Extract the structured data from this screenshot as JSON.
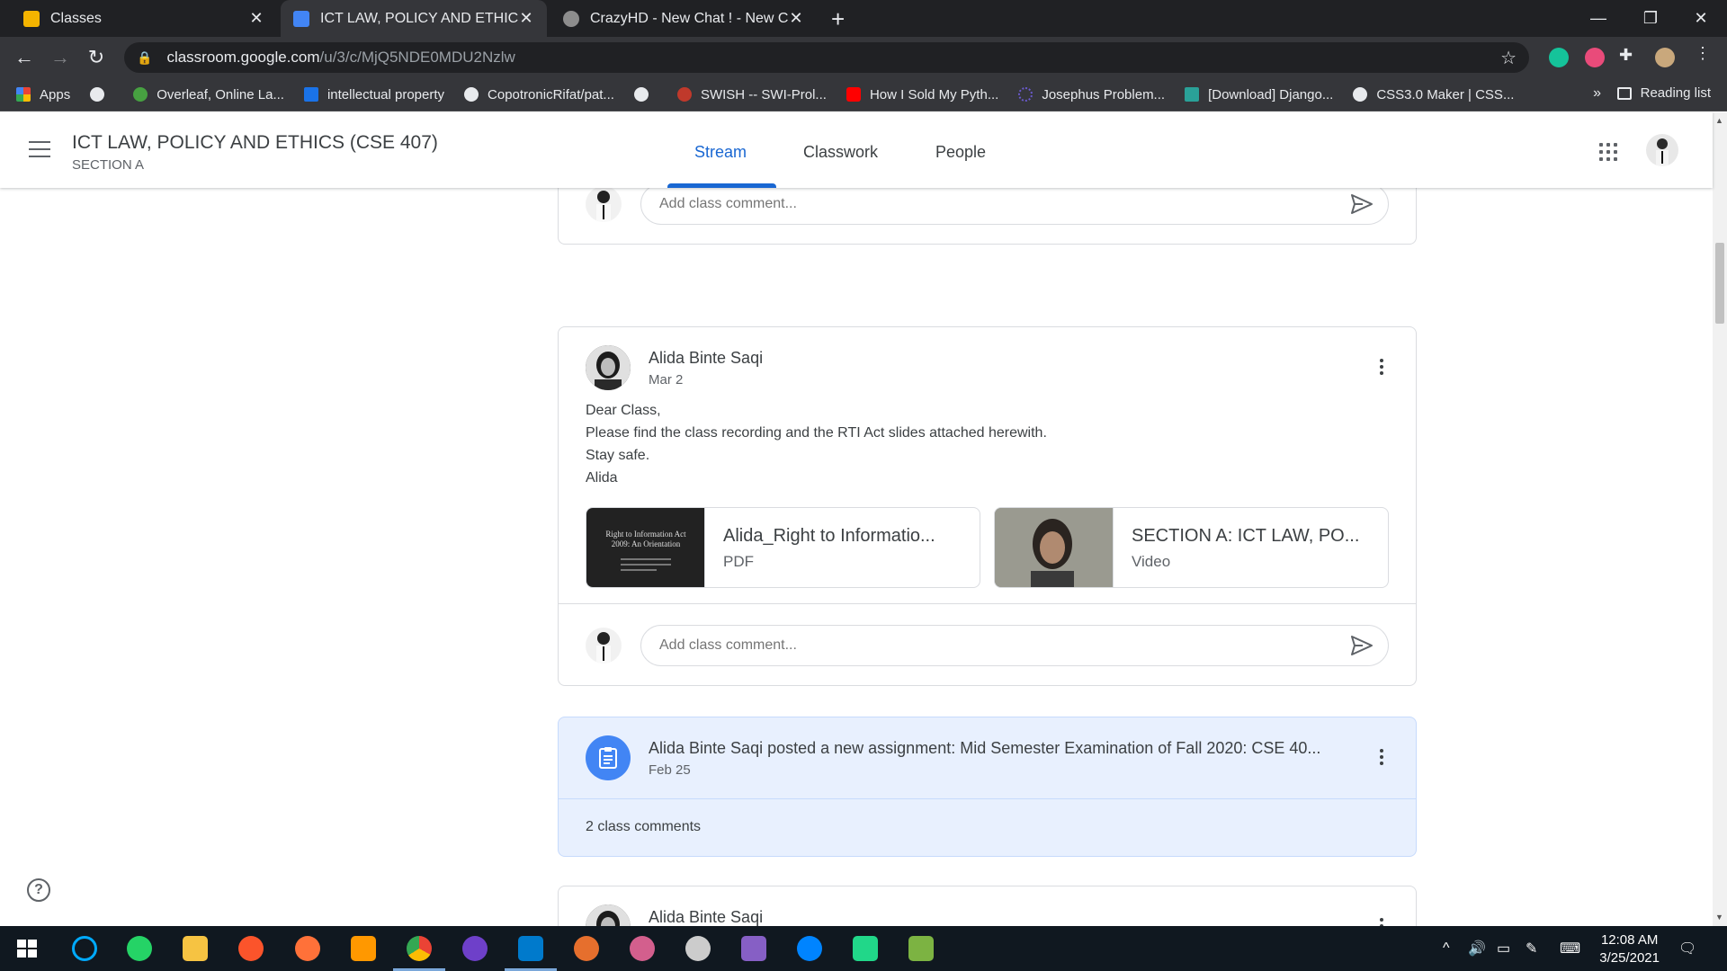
{
  "browser": {
    "tabs": [
      {
        "title": "Classes",
        "favicon_color": "#f4b400"
      },
      {
        "title": "ICT LAW, POLICY AND ETHICS (C",
        "favicon_color": "#4285f4"
      },
      {
        "title": "CrazyHD - New Chat ! - New Cha",
        "favicon_color": "#8d8d8d"
      }
    ],
    "url_host": "classroom.google.com",
    "url_path": "/u/3/c/MjQ5NDE0MDU2Nzlw",
    "bookmarks": [
      {
        "label": "Apps",
        "color": "#ea4335"
      },
      {
        "label": "",
        "color": "#e8eaed"
      },
      {
        "label": "Overleaf, Online La...",
        "color": "#47a141"
      },
      {
        "label": "intellectual property",
        "color": "#1a73e8"
      },
      {
        "label": "CopotronicRifat/pat...",
        "color": "#e8eaed"
      },
      {
        "label": "",
        "color": "#e8eaed"
      },
      {
        "label": "SWISH -- SWI-Prol...",
        "color": "#c0392b"
      },
      {
        "label": "How I Sold My Pyth...",
        "color": "#ff0000"
      },
      {
        "label": "Josephus Problem...",
        "color": "#6a5acd"
      },
      {
        "label": "[Download] Django...",
        "color": "#2aa198"
      },
      {
        "label": "CSS3.0 Maker | CSS...",
        "color": "#e8eaed"
      }
    ],
    "bookmarks_more": "»",
    "reading_list": "Reading list"
  },
  "classroom": {
    "course_title": "ICT LAW, POLICY AND ETHICS (CSE 407)",
    "section": "SECTION A",
    "nav_tabs": [
      "Stream",
      "Classwork",
      "People"
    ],
    "comment_placeholder": "Add class comment...",
    "post": {
      "author": "Alida Binte Saqi",
      "date": "Mar 2",
      "body_lines": [
        "Dear Class,",
        "Please find the class recording and the RTI Act slides attached herewith.",
        "Stay safe.",
        "Alida"
      ],
      "attachments": [
        {
          "title": "Alida_Right to Informatio...",
          "type": "PDF",
          "thumb_text_1": "Right to Information Act",
          "thumb_text_2": "2009: An Orientation"
        },
        {
          "title": "SECTION A: ICT LAW, PO...",
          "type": "Video"
        }
      ]
    },
    "assignment": {
      "title": "Alida Binte Saqi posted a new assignment: Mid Semester Examination of Fall 2020: CSE 40...",
      "date": "Feb 25",
      "comments": "2 class comments"
    },
    "next_post_author": "Alida Binte Saqi",
    "help_symbol": "?"
  },
  "taskbar": {
    "time": "12:08 AM",
    "date": "3/25/2021",
    "apps": [
      "start",
      "search",
      "whatsapp",
      "file-explorer",
      "brave",
      "firefox",
      "sublime",
      "chrome",
      "github-desktop",
      "vscode",
      "matlab",
      "snipping",
      "inkscape",
      "visual-studio",
      "messenger",
      "pycharm",
      "notepad"
    ]
  },
  "colors": {
    "accent": "#1967d2",
    "assignment_bg": "#e8f0fe",
    "chrome_dark": "#202124"
  }
}
